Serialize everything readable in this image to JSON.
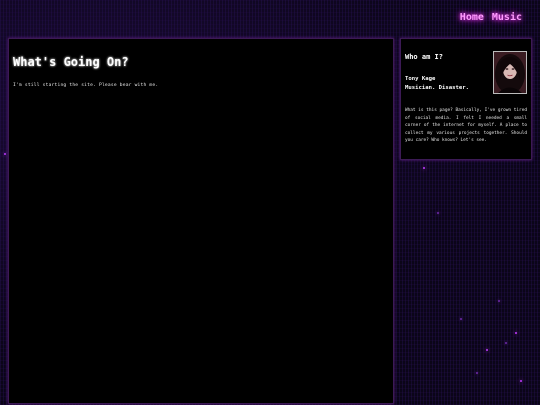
{
  "nav": {
    "items": [
      {
        "label": "Home"
      },
      {
        "label": "Music"
      }
    ]
  },
  "main": {
    "title": "What's Going On?",
    "text": "I'm still starting the site. Please bear with me."
  },
  "sidebar": {
    "title": "Who am I?",
    "name": "Tony Kage",
    "tagline": "Musician. Disaster.",
    "bio": "What is this page? Basically, I've grown tired of social media. I felt I needed a small corner of the internet for myself. A place to collect my various projects together. Should you care? Who knows? Let's see."
  },
  "colors": {
    "background": "#0b0518",
    "panel": "#000000",
    "nav_glow": "#ff3cf0",
    "border": "#3c1a55"
  }
}
